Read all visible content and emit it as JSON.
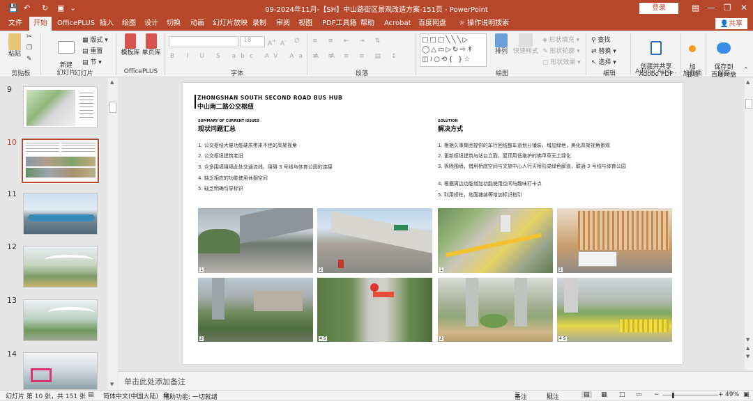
{
  "titlebar": {
    "title": "09-2024年11月-【SH】中山路街区景观改造方案-151页  -  PowerPoint",
    "login": "登录"
  },
  "tabs": [
    {
      "label": "文件"
    },
    {
      "label": "开始"
    },
    {
      "label": "OfficePLUS"
    },
    {
      "label": "插入"
    },
    {
      "label": "绘图"
    },
    {
      "label": "设计"
    },
    {
      "label": "切换"
    },
    {
      "label": "动画"
    },
    {
      "label": "幻灯片放映"
    },
    {
      "label": "录制"
    },
    {
      "label": "审阅"
    },
    {
      "label": "视图"
    },
    {
      "label": "PDF工具箱"
    },
    {
      "label": "帮助"
    },
    {
      "label": "Acrobat"
    },
    {
      "label": "百度网盘"
    },
    {
      "label": "操作说明搜索"
    }
  ],
  "share": "共享",
  "ribbon": {
    "paste": "粘贴",
    "clipboard": "剪贴板",
    "new_slide": "新建\n幻灯片",
    "layout": "版式",
    "reset": "重置",
    "section": "节",
    "slides": "幻灯片",
    "template_lib": "模板库",
    "single_lib": "单页库",
    "officeplus": "OfficePLUS",
    "font_size": "18",
    "font": "字体",
    "paragraph": "段落",
    "arrange": "排列",
    "quick_styles": "快速样式",
    "shape_fill": "形状填充",
    "shape_outline": "形状轮廓",
    "shape_effect": "形状效果",
    "drawing": "绘图",
    "find": "查找",
    "replace": "替换",
    "select": "选择",
    "editing": "编辑",
    "create_pdf": "创建并共享\nAdobe PDF",
    "adobe_acro": "Adobe Acro...",
    "add_in": "加\n载项",
    "add_ins": "加载项",
    "save_baidu": "保存到\n百度网盘",
    "save": "保存"
  },
  "thumbs": [
    {
      "num": "9"
    },
    {
      "num": "10"
    },
    {
      "num": "11"
    },
    {
      "num": "12"
    },
    {
      "num": "13"
    },
    {
      "num": "14"
    }
  ],
  "slide": {
    "title_en": "ZHONGSHAN SOUTH SECOND ROAD BUS HUB",
    "title_cn": "中山南二路公交枢纽",
    "left_en": "SUMMARY OF CURRENT ISSUES",
    "left_cn": "现状问题汇总",
    "left_items": [
      "1. 公交枢纽大量功能硬质带来不佳的高架视角",
      "2. 公交枢纽建筑老旧",
      "3. 众多围墙阻隔此处交通流线，阻碍 3 号线与体育公园的连接",
      "4. 缺乏相应的功能使用休憩空间",
      "5. 缺乏明确引导标识"
    ],
    "right_en": "SOLUTION",
    "right_cn": "解决方式",
    "right_items": [
      "1. 根据久事集团提供的车行回线整车道划分铺装，增加绿地，美化高架视角景观",
      "2. 更新枢纽建筑与站台立面，屋顶用低维护的佛甲草无土绿化",
      "3. 拆除围墙，借用桥底空间与文旅中心人行天桥形成绿色廊道，联通 3 号线与体育公园",
      "4. 根据周边功能增加功能使用空间与趣味打卡点",
      "5. 利用桥柱，地面铺装等增加标识指引"
    ],
    "photo_labels": [
      "1",
      "2",
      "1",
      "2",
      "2",
      "4  5",
      "2",
      "4  5"
    ]
  },
  "notes_placeholder": "单击此处添加备注",
  "status": {
    "slide_info": "幻灯片 第 10 张，共 151 张",
    "language": "简体中文(中国大陆)",
    "accessibility": "辅助功能: 一切就绪",
    "notes_btn": "备注",
    "comments_btn": "批注",
    "zoom": "49%"
  },
  "colors": {
    "accent": "#b7472a"
  }
}
